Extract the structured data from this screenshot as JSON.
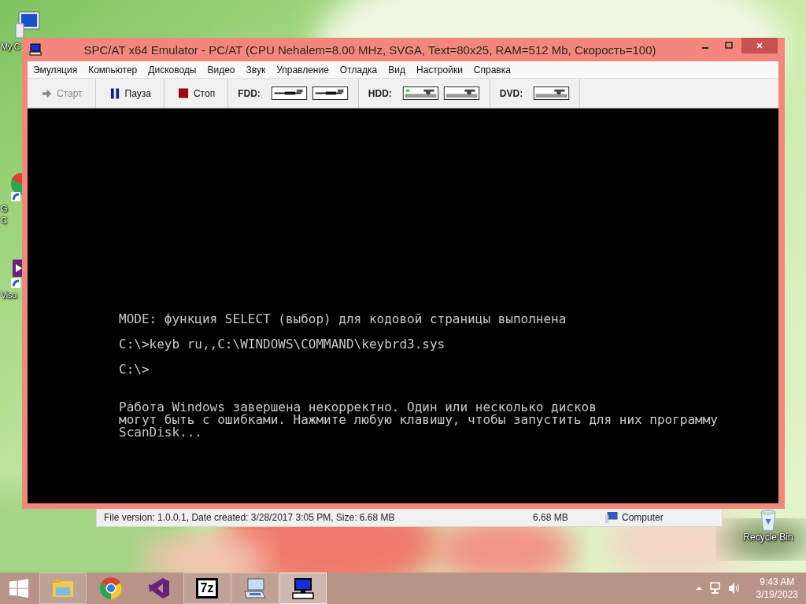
{
  "desktop_icons": [
    {
      "kind": "computer",
      "label": "My C"
    },
    {
      "kind": "chrome",
      "label": "G\nC"
    },
    {
      "kind": "studio",
      "label": "Visu"
    }
  ],
  "recycle_bin": {
    "label": "Recycle Bin"
  },
  "explorer_status_bar": {
    "details": "File version: 1.0.0.1, Date created: 3/28/2017 3:05 PM, Size: 6.68 MB",
    "size": "6.68 MB",
    "location": "Computer"
  },
  "window": {
    "title": "SPC/AT x64 Emulator - PC/AT (CPU Nehalem=8.00 MHz, SVGA, Text=80x25, RAM=512 Mb, Скорость=100)"
  },
  "menu": [
    "Эмуляция",
    "Компьютер",
    "Дисководы",
    "Видео",
    "Звук",
    "Управление",
    "Отладка",
    "Вид",
    "Настройки",
    "Справка"
  ],
  "toolbar": {
    "buttons": [
      {
        "kind": "start",
        "label": "Старт",
        "disabled": true
      },
      {
        "kind": "pause",
        "label": "Пауза",
        "disabled": false
      },
      {
        "kind": "stop",
        "label": "Стоп",
        "disabled": false
      }
    ],
    "drive_groups": [
      {
        "label": "FDD:",
        "drives": [
          {
            "kind": "floppy",
            "active": false
          },
          {
            "kind": "floppy",
            "active": false
          }
        ]
      },
      {
        "label": "HDD:",
        "drives": [
          {
            "kind": "disk",
            "active": true
          },
          {
            "kind": "disk",
            "active": false
          }
        ]
      },
      {
        "label": "DVD:",
        "drives": [
          {
            "kind": "disk",
            "active": false
          }
        ]
      }
    ]
  },
  "screen": {
    "blocks": [
      [
        "MODE: функция SELECT (выбор) для кодовой страницы выполнена"
      ],
      [
        "C:\\>keyb ru,,C:\\WINDOWS\\COMMAND\\keybrd3.sys"
      ],
      [
        "C:\\>"
      ],
      [
        "Работа Windows завершена некорректно. Один или несколько дисков",
        "могут быть с ошибками. Нажмите любую клавишу, чтобы запустить для них программу",
        "ScanDisk..."
      ]
    ]
  },
  "taskbar": {
    "items": [
      {
        "kind": "explorer",
        "running": true,
        "selected": false
      },
      {
        "kind": "chrome",
        "running": false,
        "selected": false
      },
      {
        "kind": "studio",
        "running": false,
        "selected": false
      },
      {
        "kind": "archiver",
        "label": "7z",
        "running": true,
        "selected": false
      },
      {
        "kind": "keyboard",
        "running": true,
        "selected": false
      },
      {
        "kind": "emulator",
        "running": true,
        "selected": true
      }
    ],
    "time": "9:43 AM",
    "date": "3/19/2023"
  }
}
